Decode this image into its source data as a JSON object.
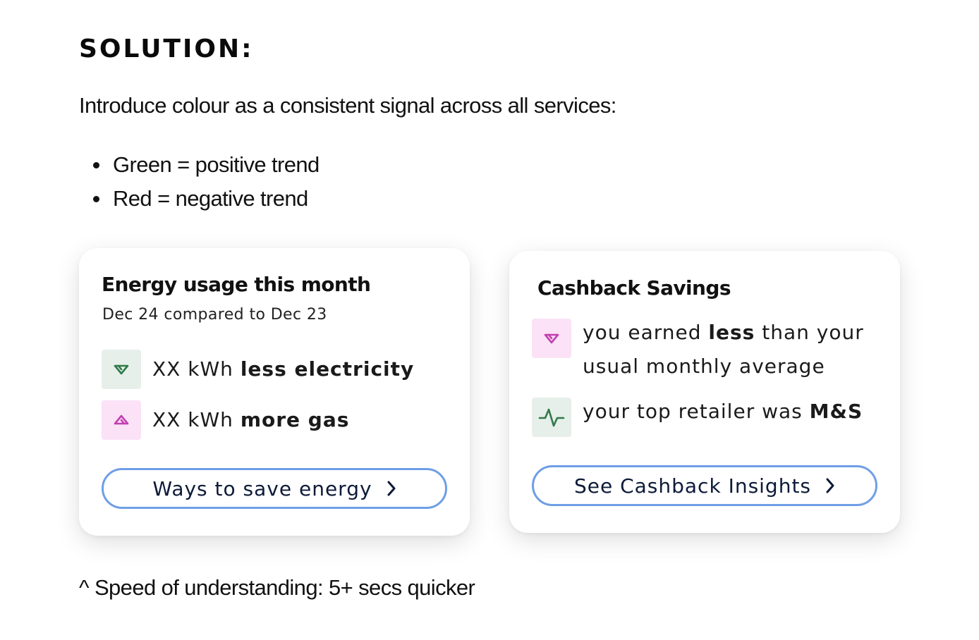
{
  "heading": "SOLUTION:",
  "intro": "Introduce colour as a consistent signal across all services:",
  "bullets": [
    {
      "text": "Green = positive trend"
    },
    {
      "text": "Red = negative trend"
    }
  ],
  "energy_card": {
    "title": "Energy usage this month",
    "subtitle": "Dec 24 compared to Dec 23",
    "rows": [
      {
        "icon": "trend-down-icon",
        "tone": "green",
        "prefix": "XX kWh ",
        "emphasis": "less electricity",
        "suffix": ""
      },
      {
        "icon": "trend-up-icon",
        "tone": "pink",
        "prefix": "XX kWh ",
        "emphasis": "more gas",
        "suffix": ""
      }
    ],
    "cta_label": "Ways to save energy"
  },
  "cashback_card": {
    "title": "Cashback Savings",
    "rows": [
      {
        "icon": "trend-down-icon",
        "tone": "pink",
        "prefix": "you earned ",
        "emphasis": "less",
        "suffix": " than your usual monthly average"
      },
      {
        "icon": "activity-pulse-icon",
        "tone": "green",
        "prefix": "your top retailer was ",
        "emphasis": "M&S",
        "suffix": ""
      }
    ],
    "cta_label": "See Cashback Insights"
  },
  "footnote": "^ Speed of understanding:  5+ secs quicker",
  "colors": {
    "green_icon": "#2f7a4a",
    "green_chip": "#e7efea",
    "pink_icon": "#c23fb1",
    "pink_chip": "#fbe2f6",
    "cta_border": "#6f9ee6",
    "cta_text": "#0d1a38"
  }
}
